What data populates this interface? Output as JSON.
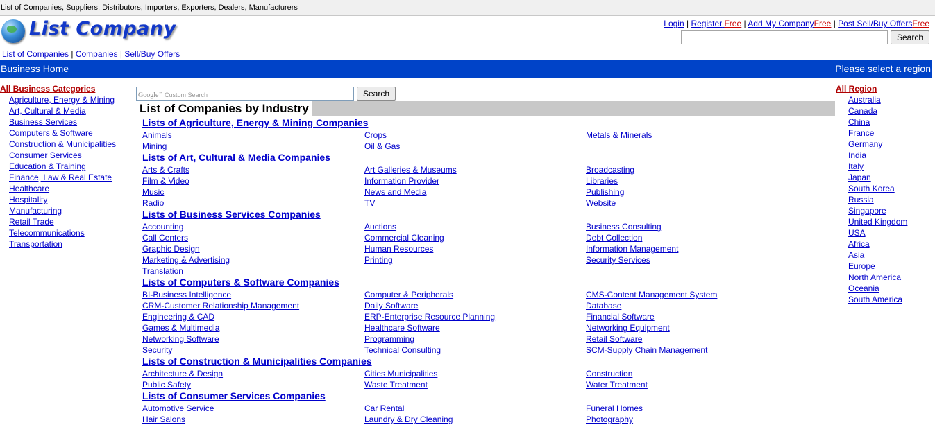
{
  "topstrip": "List of Companies, Suppliers, Distributors, Importers, Exporters, Dealers, Manufacturers",
  "logo": {
    "text": "List Company"
  },
  "toplinks": {
    "login": "Login",
    "register": "Register",
    "register_free": "Free",
    "addco": "Add My Company",
    "addco_free": "Free",
    "post": "Post Sell/Buy Offers",
    "post_free": "Free"
  },
  "top_search": {
    "value": "",
    "button": "Search"
  },
  "nav": {
    "list": "List of Companies",
    "companies": "Companies",
    "offers": "Sell/Buy Offers"
  },
  "bluebar": {
    "left": "Business Home",
    "right": "Please select a region"
  },
  "left": {
    "header": "All Business Categories",
    "items": [
      "Agriculture, Energy & Mining",
      "Art, Cultural & Media",
      "Business Services",
      "Computers & Software",
      "Construction & Municipalities",
      "Consumer Services",
      "Education & Training",
      "Finance, Law & Real Estate",
      "Healthcare",
      "Hospitality",
      "Manufacturing",
      "Retail Trade",
      "Telecommunications",
      "Transportation"
    ]
  },
  "right": {
    "header": "All Region",
    "items": [
      "Australia",
      "Canada",
      "China",
      "France",
      "Germany",
      "India",
      "Italy",
      "Japan",
      "South Korea",
      "Russia",
      "Singapore",
      "United Kingdom",
      "USA",
      "Africa",
      "Asia",
      "Europe",
      "North America",
      "Oceania",
      "South America"
    ]
  },
  "gsearch": {
    "brand": "Google",
    "placeholder": "Custom Search",
    "button": "Search"
  },
  "title": "List of Companies by Industry",
  "categories": [
    {
      "title": "Lists of Agriculture, Energy & Mining Companies",
      "items": [
        "Animals",
        "Crops",
        "Metals & Minerals",
        "Mining",
        "Oil & Gas"
      ]
    },
    {
      "title": "Lists of Art, Cultural & Media Companies",
      "items": [
        "Arts & Crafts",
        "Art Galleries & Museums",
        "Broadcasting",
        "Film & Video",
        "Information Provider",
        "Libraries",
        "Music",
        "News and Media",
        "Publishing",
        "Radio",
        "TV",
        "Website"
      ]
    },
    {
      "title": "Lists of Business Services Companies",
      "items": [
        "Accounting",
        "Auctions",
        "Business Consulting",
        "Call Centers",
        "Commercial Cleaning",
        "Debt Collection",
        "Graphic Design",
        "Human Resources",
        "Information Management",
        "Marketing & Advertising",
        "Printing",
        "Security Services",
        "Translation"
      ]
    },
    {
      "title": "Lists of Computers & Software Companies",
      "items": [
        "BI-Business Intelligence",
        "Computer & Peripherals",
        "CMS-Content Management System",
        "CRM-Customer Relationship Management",
        "Daily Software",
        "Database",
        "Engineering & CAD",
        "ERP-Enterprise Resource Planning",
        "Financial Software",
        "Games & Multimedia",
        "Healthcare Software",
        "Networking Equipment",
        "Networking Software",
        "Programming",
        "Retail Software",
        "Security",
        "Technical Consulting",
        "SCM-Supply Chain Management"
      ]
    },
    {
      "title": "Lists of Construction & Municipalities Companies",
      "items": [
        "Architecture & Design",
        "Cities Municipalities",
        "Construction",
        "Public Safety",
        "Waste Treatment",
        "Water Treatment"
      ]
    },
    {
      "title": "Lists of Consumer Services Companies",
      "items": [
        "Automotive Service",
        "Car Rental",
        "Funeral Homes",
        "Hair Salons",
        "Laundry & Dry Cleaning",
        "Photography"
      ]
    }
  ]
}
